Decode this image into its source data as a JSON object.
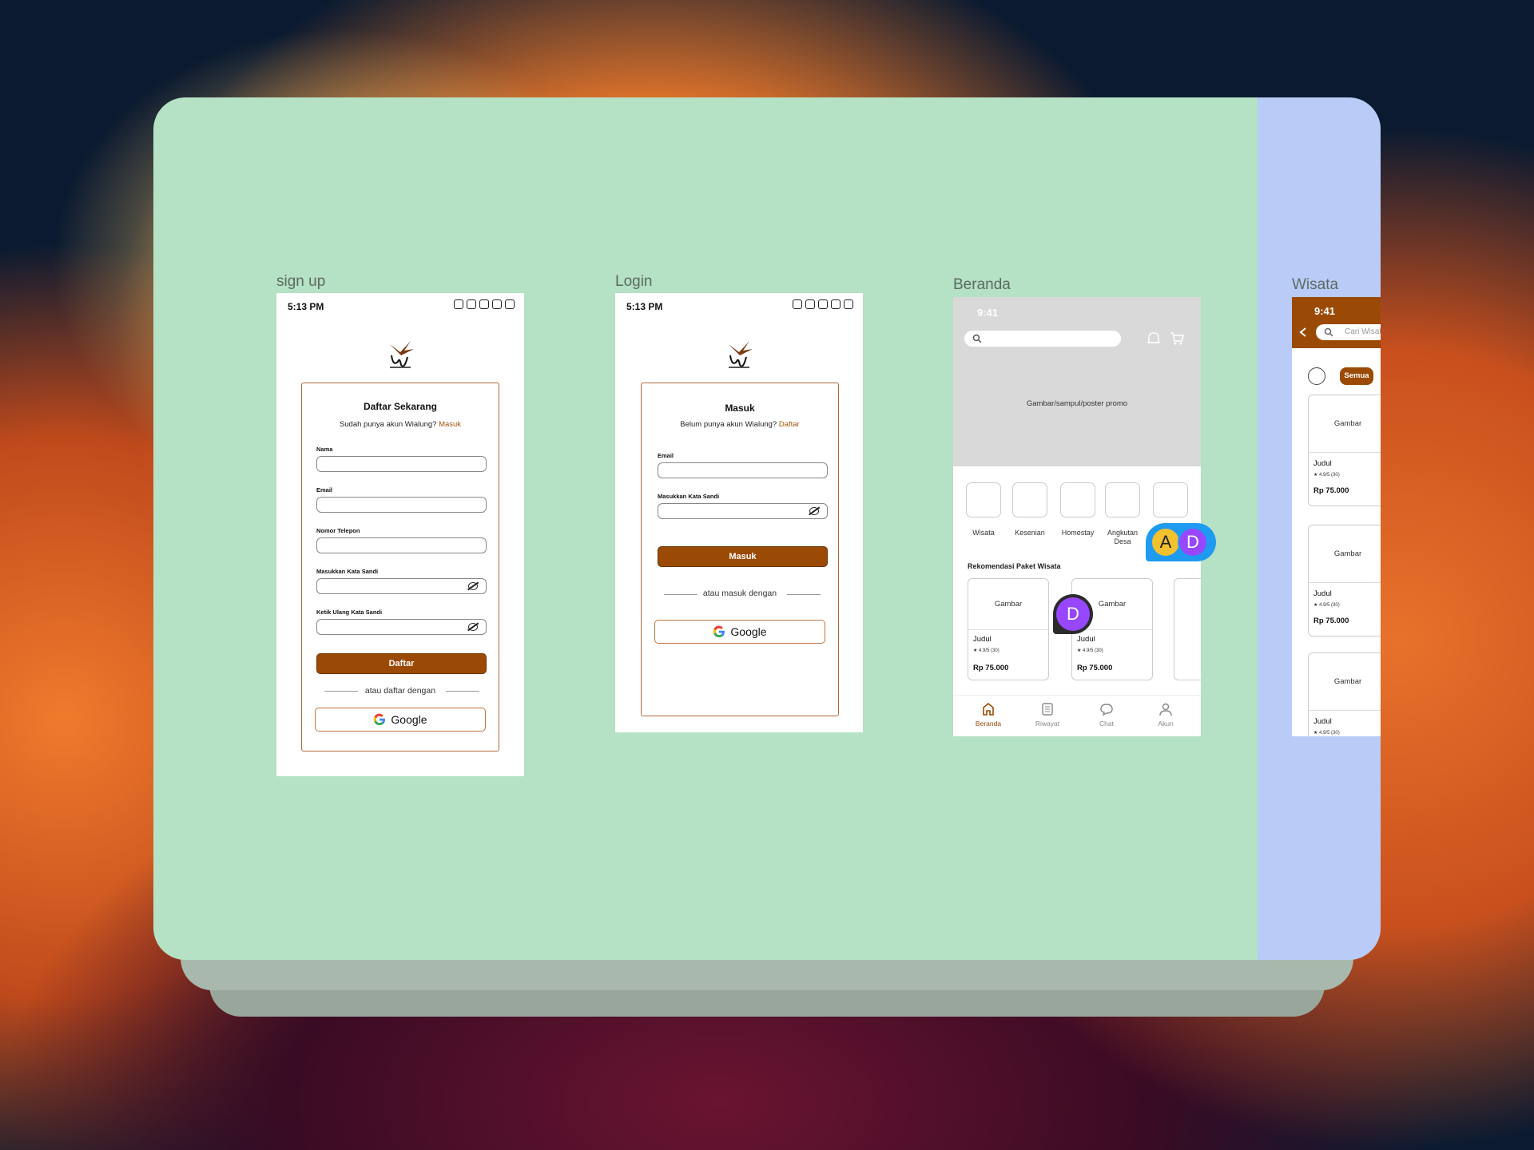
{
  "frames": {
    "signup_label": "sign up",
    "login_label": "Login",
    "beranda_label": "Beranda",
    "wisata_label": "Wisata"
  },
  "signup": {
    "time": "5:13 PM",
    "title": "Daftar Sekarang",
    "subtitle": "Sudah punya akun Wialung?",
    "subtitle_link": "Masuk",
    "fields": [
      "Nama",
      "Email",
      "Nomor Telepon",
      "Masukkan Kata Sandi",
      "Ketik Ulang Kata Sandi"
    ],
    "button": "Daftar",
    "divider": "atau daftar dengan",
    "google": "Google"
  },
  "login": {
    "time": "5:13 PM",
    "title": "Masuk",
    "subtitle": "Belum punya akun Wialung?",
    "subtitle_link": "Daftar",
    "fields": [
      "Email",
      "Masukkan Kata Sandi"
    ],
    "button": "Masuk",
    "divider": "atau masuk dengan",
    "google": "Google"
  },
  "beranda": {
    "time": "9:41",
    "promo": "Gambar/sampul/poster promo",
    "categories": [
      "Wisata",
      "Kesenian",
      "Homestay",
      "Angkutan Desa"
    ],
    "section_title": "Rekomendasi Paket Wisata",
    "cards": [
      {
        "image": "Gambar",
        "title": "Judul",
        "rating": "4.9/5 (30)",
        "price": "Rp 75.000"
      },
      {
        "image": "Gambar",
        "title": "Judul",
        "rating": "4.9/5 (30)",
        "price": "Rp 75.000"
      }
    ],
    "nav": [
      "Beranda",
      "Riwayat",
      "Chat",
      "Akun"
    ]
  },
  "wisata": {
    "time": "9:41",
    "search_placeholder": "Cari Wisata",
    "chip": "Semua",
    "cards": [
      {
        "image": "Gambar",
        "title": "Judul",
        "rating": "4.9/5 (30)",
        "price": "Rp 75.000"
      },
      {
        "image": "Gambar",
        "title": "Judul",
        "rating": "4.9/5 (30)",
        "price": "Rp 75.000"
      },
      {
        "image": "Gambar",
        "title": "Judul",
        "rating": "4.9/5 (30)"
      }
    ]
  },
  "collaborators": [
    "A",
    "D",
    "D"
  ],
  "colors": {
    "accent": "#9a4a05",
    "canvas": "#b5e1c4",
    "lavender": "#b9cbf7",
    "avatar_a": "#f2c12e",
    "avatar_d": "#9747ff"
  }
}
